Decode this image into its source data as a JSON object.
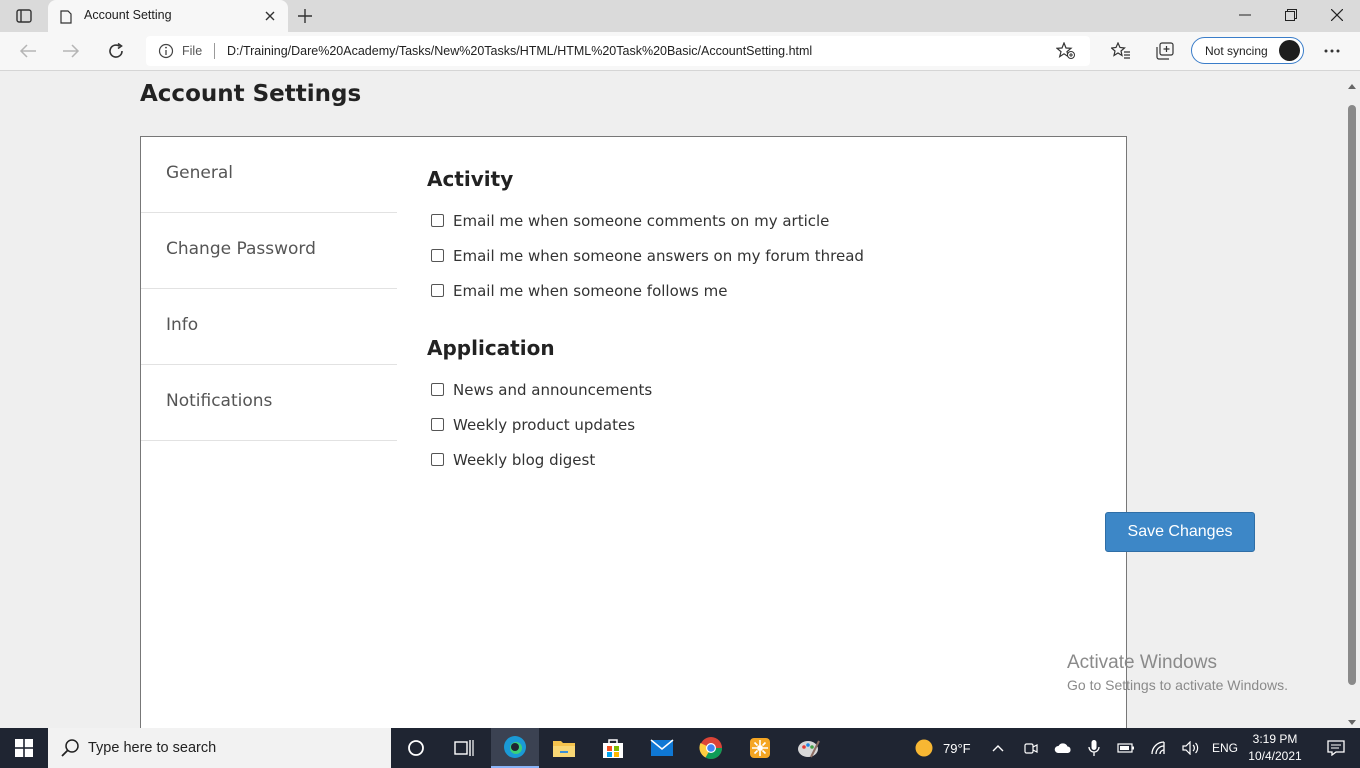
{
  "browser": {
    "tab_title": "Account Setting",
    "url_scheme": "File",
    "url": "D:/Training/Dare%20Academy/Tasks/New%20Tasks/HTML/HTML%20Task%20Basic/AccountSetting.html",
    "sync_label": "Not syncing"
  },
  "page": {
    "title": "Account Settings",
    "sidebar": {
      "items": [
        {
          "label": "General"
        },
        {
          "label": "Change Password"
        },
        {
          "label": "Info"
        },
        {
          "label": "Notifications"
        }
      ]
    },
    "sections": [
      {
        "title": "Activity",
        "options": [
          {
            "label": "Email me when someone comments on my article",
            "checked": false
          },
          {
            "label": "Email me when someone answers on my forum thread",
            "checked": false
          },
          {
            "label": "Email me when someone follows me",
            "checked": false
          }
        ]
      },
      {
        "title": "Application",
        "options": [
          {
            "label": "News and announcements",
            "checked": false
          },
          {
            "label": "Weekly product updates",
            "checked": false
          },
          {
            "label": "Weekly blog digest",
            "checked": false
          }
        ]
      }
    ],
    "save_label": "Save Changes",
    "accent": "#3d87c7"
  },
  "watermark": {
    "line1": "Activate Windows",
    "line2": "Go to Settings to activate Windows."
  },
  "taskbar": {
    "search_placeholder": "Type here to search",
    "weather": "79°F",
    "language": "ENG",
    "time": "3:19 PM",
    "date": "10/4/2021"
  }
}
